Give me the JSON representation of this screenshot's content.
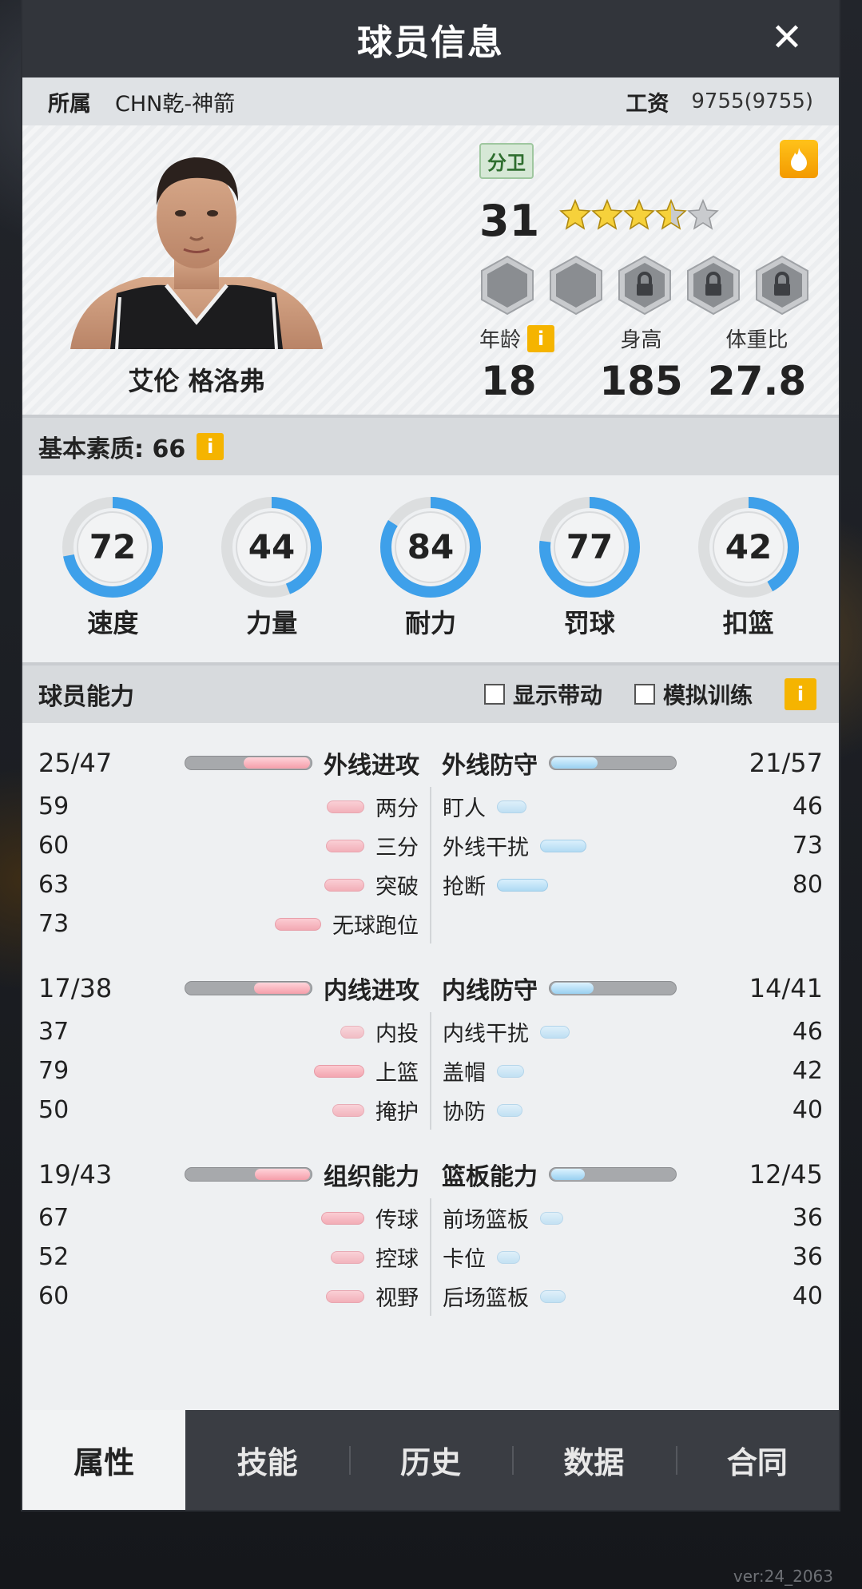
{
  "header": {
    "title": "球员信息",
    "close_icon": "close-icon"
  },
  "info": {
    "team_label": "所属",
    "team": "CHN乾-神箭",
    "salary_label": "工资",
    "salary": "9755(9755)"
  },
  "player": {
    "name": "艾伦 格洛弗",
    "position": "分卫",
    "overall": "31",
    "stars": 3.5,
    "stars_total": 5,
    "hexes": [
      {
        "state": "unlocked"
      },
      {
        "state": "unlocked"
      },
      {
        "state": "locked"
      },
      {
        "state": "locked"
      },
      {
        "state": "locked"
      }
    ],
    "age_label": "年龄",
    "age": "18",
    "height_label": "身高",
    "height": "185",
    "bmi_label": "体重比",
    "bmi": "27.8",
    "info_icon": "i"
  },
  "basic": {
    "label": "基本素质: 66",
    "gauges": [
      {
        "label": "速度",
        "value": "72"
      },
      {
        "label": "力量",
        "value": "44"
      },
      {
        "label": "耐力",
        "value": "84"
      },
      {
        "label": "罚球",
        "value": "77"
      },
      {
        "label": "扣篮",
        "value": "42"
      }
    ]
  },
  "abilities_header": {
    "title": "球员能力",
    "toggle1": "显示带动",
    "toggle2": "模拟训练"
  },
  "blocks": [
    {
      "left": {
        "title": "外线进攻",
        "score": "25/47",
        "ratio": 0.53,
        "rows": [
          {
            "name": "两分",
            "value": "59"
          },
          {
            "name": "三分",
            "value": "60"
          },
          {
            "name": "突破",
            "value": "63"
          },
          {
            "name": "无球跑位",
            "value": "73"
          }
        ]
      },
      "right": {
        "title": "外线防守",
        "score": "21/57",
        "ratio": 0.37,
        "rows": [
          {
            "name": "盯人",
            "value": "46"
          },
          {
            "name": "外线干扰",
            "value": "73"
          },
          {
            "name": "抢断",
            "value": "80"
          }
        ]
      }
    },
    {
      "left": {
        "title": "内线进攻",
        "score": "17/38",
        "ratio": 0.45,
        "rows": [
          {
            "name": "内投",
            "value": "37"
          },
          {
            "name": "上篮",
            "value": "79"
          },
          {
            "name": "掩护",
            "value": "50"
          }
        ]
      },
      "right": {
        "title": "内线防守",
        "score": "14/41",
        "ratio": 0.34,
        "rows": [
          {
            "name": "内线干扰",
            "value": "46"
          },
          {
            "name": "盖帽",
            "value": "42"
          },
          {
            "name": "协防",
            "value": "40"
          }
        ]
      }
    },
    {
      "left": {
        "title": "组织能力",
        "score": "19/43",
        "ratio": 0.44,
        "rows": [
          {
            "name": "传球",
            "value": "67"
          },
          {
            "name": "控球",
            "value": "52"
          },
          {
            "name": "视野",
            "value": "60"
          }
        ]
      },
      "right": {
        "title": "篮板能力",
        "score": "12/45",
        "ratio": 0.27,
        "rows": [
          {
            "name": "前场篮板",
            "value": "36"
          },
          {
            "name": "卡位",
            "value": "36"
          },
          {
            "name": "后场篮板",
            "value": "40"
          }
        ]
      }
    }
  ],
  "tabs": [
    "属性",
    "技能",
    "历史",
    "数据",
    "合同"
  ],
  "active_tab": 0,
  "version": "ver:24_2063",
  "colors": {
    "accent_blue": "#3ea0ea",
    "accent_red": "#f49aa6",
    "badge_gold": "#f5b400"
  }
}
